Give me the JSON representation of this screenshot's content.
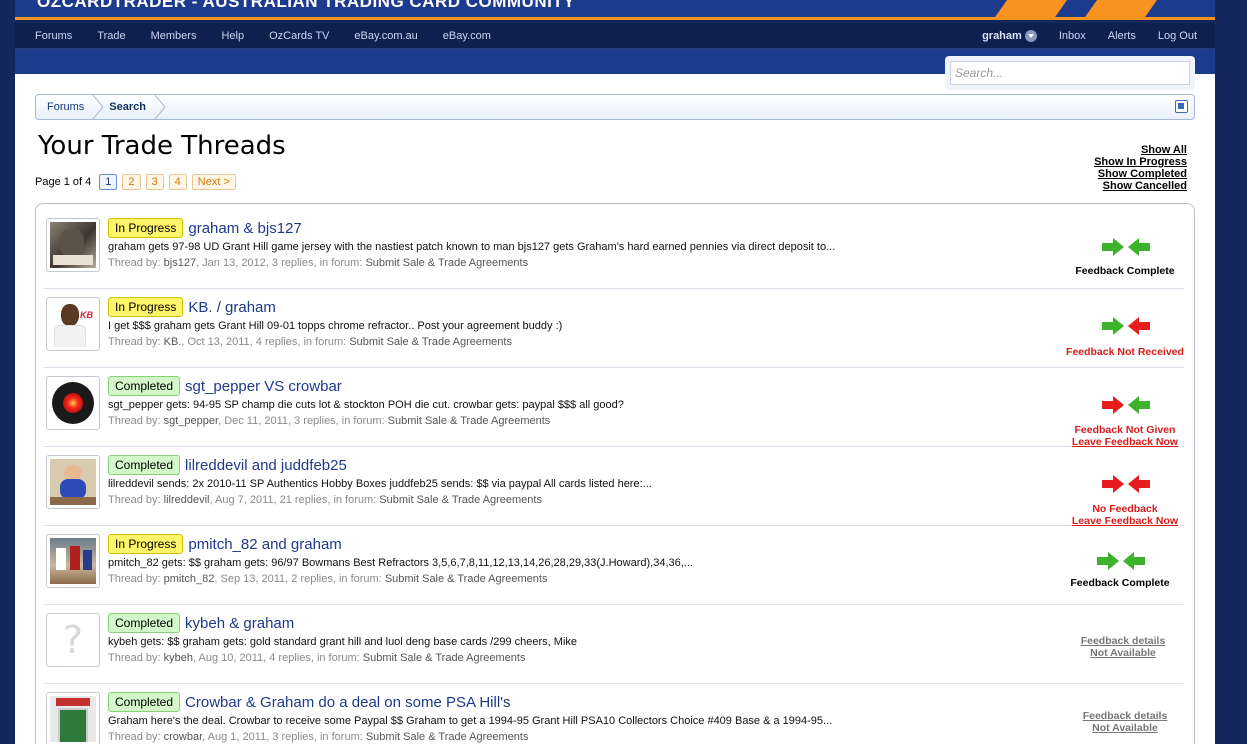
{
  "banner": {
    "title": "OZCARDTRADER - AUSTRALIAN TRADING CARD COMMUNITY"
  },
  "nav": {
    "left": [
      "Forums",
      "Trade",
      "Members",
      "Help",
      "OzCards TV",
      "eBay.com.au",
      "eBay.com"
    ],
    "user": "graham",
    "right": [
      "Inbox",
      "Alerts",
      "Log Out"
    ]
  },
  "search": {
    "placeholder": "Search..."
  },
  "breadcrumb": {
    "items": [
      "Forums",
      "Search"
    ]
  },
  "page": {
    "title": "Your Trade Threads"
  },
  "filters": [
    "Show All",
    "Show In Progress",
    "Show Completed",
    "Show Cancelled"
  ],
  "pager": {
    "label": "Page 1 of 4",
    "pages": [
      "1",
      "2",
      "3",
      "4"
    ],
    "next": "Next >"
  },
  "threads": [
    {
      "status": "In Progress",
      "title": "graham & bjs127",
      "snippet": "graham gets 97-98 UD Grant Hill game jersey with the nastiest patch known to man bjs127 gets Graham's hard earned pennies via direct deposit to...",
      "meta_prefix": "Thread by: ",
      "author": "bjs127",
      "meta_middle": ", Jan 13, 2012, 3 replies, in forum: ",
      "forum": "Submit Sale & Trade Agreements",
      "feedback_line1": "Feedback Complete",
      "feedback_line2": ""
    },
    {
      "status": "In Progress",
      "title": "KB. / graham",
      "snippet": "I get $$$ graham gets Grant Hill 09-01 topps chrome refractor.. Post your agreement buddy :)",
      "meta_prefix": "Thread by: ",
      "author": "KB.",
      "meta_middle": ", Oct 13, 2011, 4 replies, in forum: ",
      "forum": "Submit Sale & Trade Agreements",
      "feedback_line1": "Feedback Not Received",
      "feedback_line2": ""
    },
    {
      "status": "Completed",
      "title": "sgt_pepper VS crowbar",
      "snippet": "sgt_pepper gets: 94-95 SP champ die cuts lot & stockton POH die cut. crowbar gets: paypal $$$ all good?",
      "meta_prefix": "Thread by: ",
      "author": "sgt_pepper",
      "meta_middle": ", Dec 11, 2011, 3 replies, in forum: ",
      "forum": "Submit Sale & Trade Agreements",
      "feedback_line1": "Feedback Not Given",
      "feedback_line2": "Leave Feedback Now"
    },
    {
      "status": "Completed",
      "title": "lilreddevil and juddfeb25",
      "snippet": "lilreddevil sends: 2x 2010-11 SP Authentics Hobby Boxes juddfeb25 sends: $$ via paypal All cards listed here:...",
      "meta_prefix": "Thread by: ",
      "author": "lilreddevil",
      "meta_middle": ", Aug 7, 2011, 21 replies, in forum: ",
      "forum": "Submit Sale & Trade Agreements",
      "feedback_line1": "No Feedback",
      "feedback_line2": "Leave Feedback Now"
    },
    {
      "status": "In Progress",
      "title": "pmitch_82 and graham",
      "snippet": "pmitch_82 gets: $$ graham gets: 96/97 Bowmans Best Refractors 3,5,6,7,8,11,12,13,14,26,28,29,33(J.Howard),34,36,...",
      "meta_prefix": "Thread by: ",
      "author": "pmitch_82",
      "meta_middle": ", Sep 13, 2011, 2 replies, in forum: ",
      "forum": "Submit Sale & Trade Agreements",
      "feedback_line1": "Feedback Complete",
      "feedback_line2": ""
    },
    {
      "status": "Completed",
      "title": "kybeh & graham",
      "snippet": "kybeh gets: $$ graham gets: gold standard grant hill and luol deng base cards /299 cheers, Mike",
      "meta_prefix": "Thread by: ",
      "author": "kybeh",
      "meta_middle": ", Aug 10, 2011, 4 replies, in forum: ",
      "forum": "Submit Sale & Trade Agreements",
      "feedback_line1": "Feedback details",
      "feedback_line2": "Not Available"
    },
    {
      "status": "Completed",
      "title": "Crowbar & Graham do a deal on some PSA Hill's",
      "snippet": "Graham here's the deal. Crowbar to receive some Paypal $$ Graham to get a 1994-95 Grant Hill PSA10 Collectors Choice #409 Base & a 1994-95...",
      "meta_prefix": "Thread by: ",
      "author": "crowbar",
      "meta_middle": ", Aug 1, 2011, 3 replies, in forum: ",
      "forum": "Submit Sale & Trade Agreements",
      "feedback_line1": "Feedback details",
      "feedback_line2": "Not Available"
    }
  ],
  "colors": {
    "arrow_green": "#3cb32a",
    "arrow_red": "#e81c1c",
    "badge_inprogress": "#fff56a",
    "badge_completed": "#d3f7c8"
  }
}
